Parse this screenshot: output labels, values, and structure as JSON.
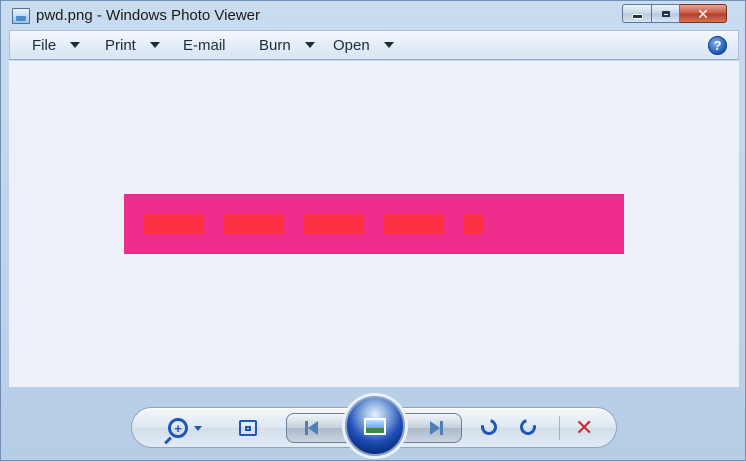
{
  "window": {
    "title": "pwd.png - Windows Photo Viewer"
  },
  "menu": {
    "items": [
      {
        "label": "File",
        "has_dropdown": true
      },
      {
        "label": "Print",
        "has_dropdown": true
      },
      {
        "label": "E-mail",
        "has_dropdown": false
      },
      {
        "label": "Burn",
        "has_dropdown": true
      },
      {
        "label": "Open",
        "has_dropdown": true
      }
    ],
    "help_glyph": "?"
  },
  "image": {
    "background_color": "#ef2d8d",
    "dot_color": "#fe3044",
    "masked_characters": 5
  },
  "controls": {
    "icons": [
      "zoom-icon",
      "actual-size-icon",
      "previous-icon",
      "slideshow-icon",
      "next-icon",
      "rotate-counterclockwise-icon",
      "rotate-clockwise-icon",
      "delete-icon"
    ],
    "zoom_glyph": "+",
    "delete_glyph": "✕"
  },
  "colors": {
    "accent": "#1f57b8",
    "close_button": "#c75a45",
    "delete": "#cc2b2b",
    "viewer_background": "#edf2fa"
  }
}
